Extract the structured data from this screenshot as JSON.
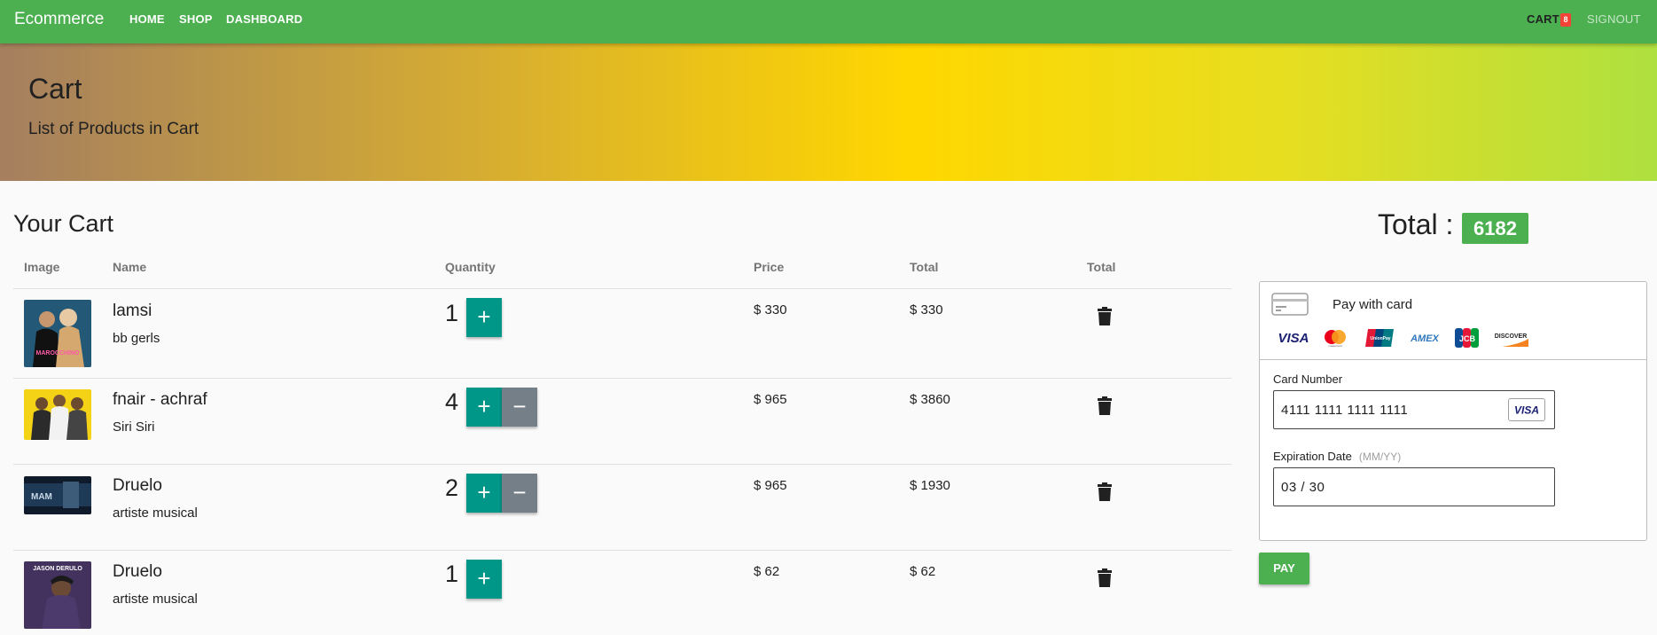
{
  "nav": {
    "brand": "Ecommerce",
    "home": "HOME",
    "shop": "SHOP",
    "dashboard": "DASHBOARD",
    "cart": "CART",
    "cart_count": "8",
    "signout": "SIGNOUT",
    "color": "#4caf50"
  },
  "banner": {
    "title": "Cart",
    "subtitle": "List of Products in Cart"
  },
  "cart": {
    "heading": "Your Cart",
    "columns": [
      "Image",
      "Name",
      "Quantity",
      "Price",
      "Total",
      "Total"
    ],
    "items": [
      {
        "name": "lamsi",
        "desc": "bb gerls",
        "qty": "1",
        "price": "$ 330",
        "total": "$ 330",
        "thumb_text": "MAROCCHINO"
      },
      {
        "name": "fnair - achraf",
        "desc": "Siri Siri",
        "qty": "4",
        "price": "$ 965",
        "total": "$ 3860"
      },
      {
        "name": "Druelo",
        "desc": "artiste musical",
        "qty": "2",
        "price": "$ 965",
        "total": "$ 1930",
        "thumb_text": "MAM"
      },
      {
        "name": "Druelo",
        "desc": "artiste musical",
        "qty": "1",
        "price": "$ 62",
        "total": "$ 62",
        "thumb_text": "JASON DERULO"
      }
    ],
    "plus_symbol": "+",
    "minus_symbol": "−"
  },
  "summary": {
    "total_label": "Total :",
    "total_value": "6182"
  },
  "payment": {
    "title": "Pay with card",
    "brands": [
      "VISA",
      "mastercard",
      "UnionPay",
      "AMEX",
      "JCB",
      "DISCOVER"
    ],
    "card_number_label": "Card Number",
    "card_number": "4111 1111 1111 1111",
    "card_brand": "VISA",
    "expiry_label": "Expiration Date",
    "expiry_hint": "(MM/YY)",
    "expiry": "03 / 30",
    "pay_button": "PAY"
  }
}
